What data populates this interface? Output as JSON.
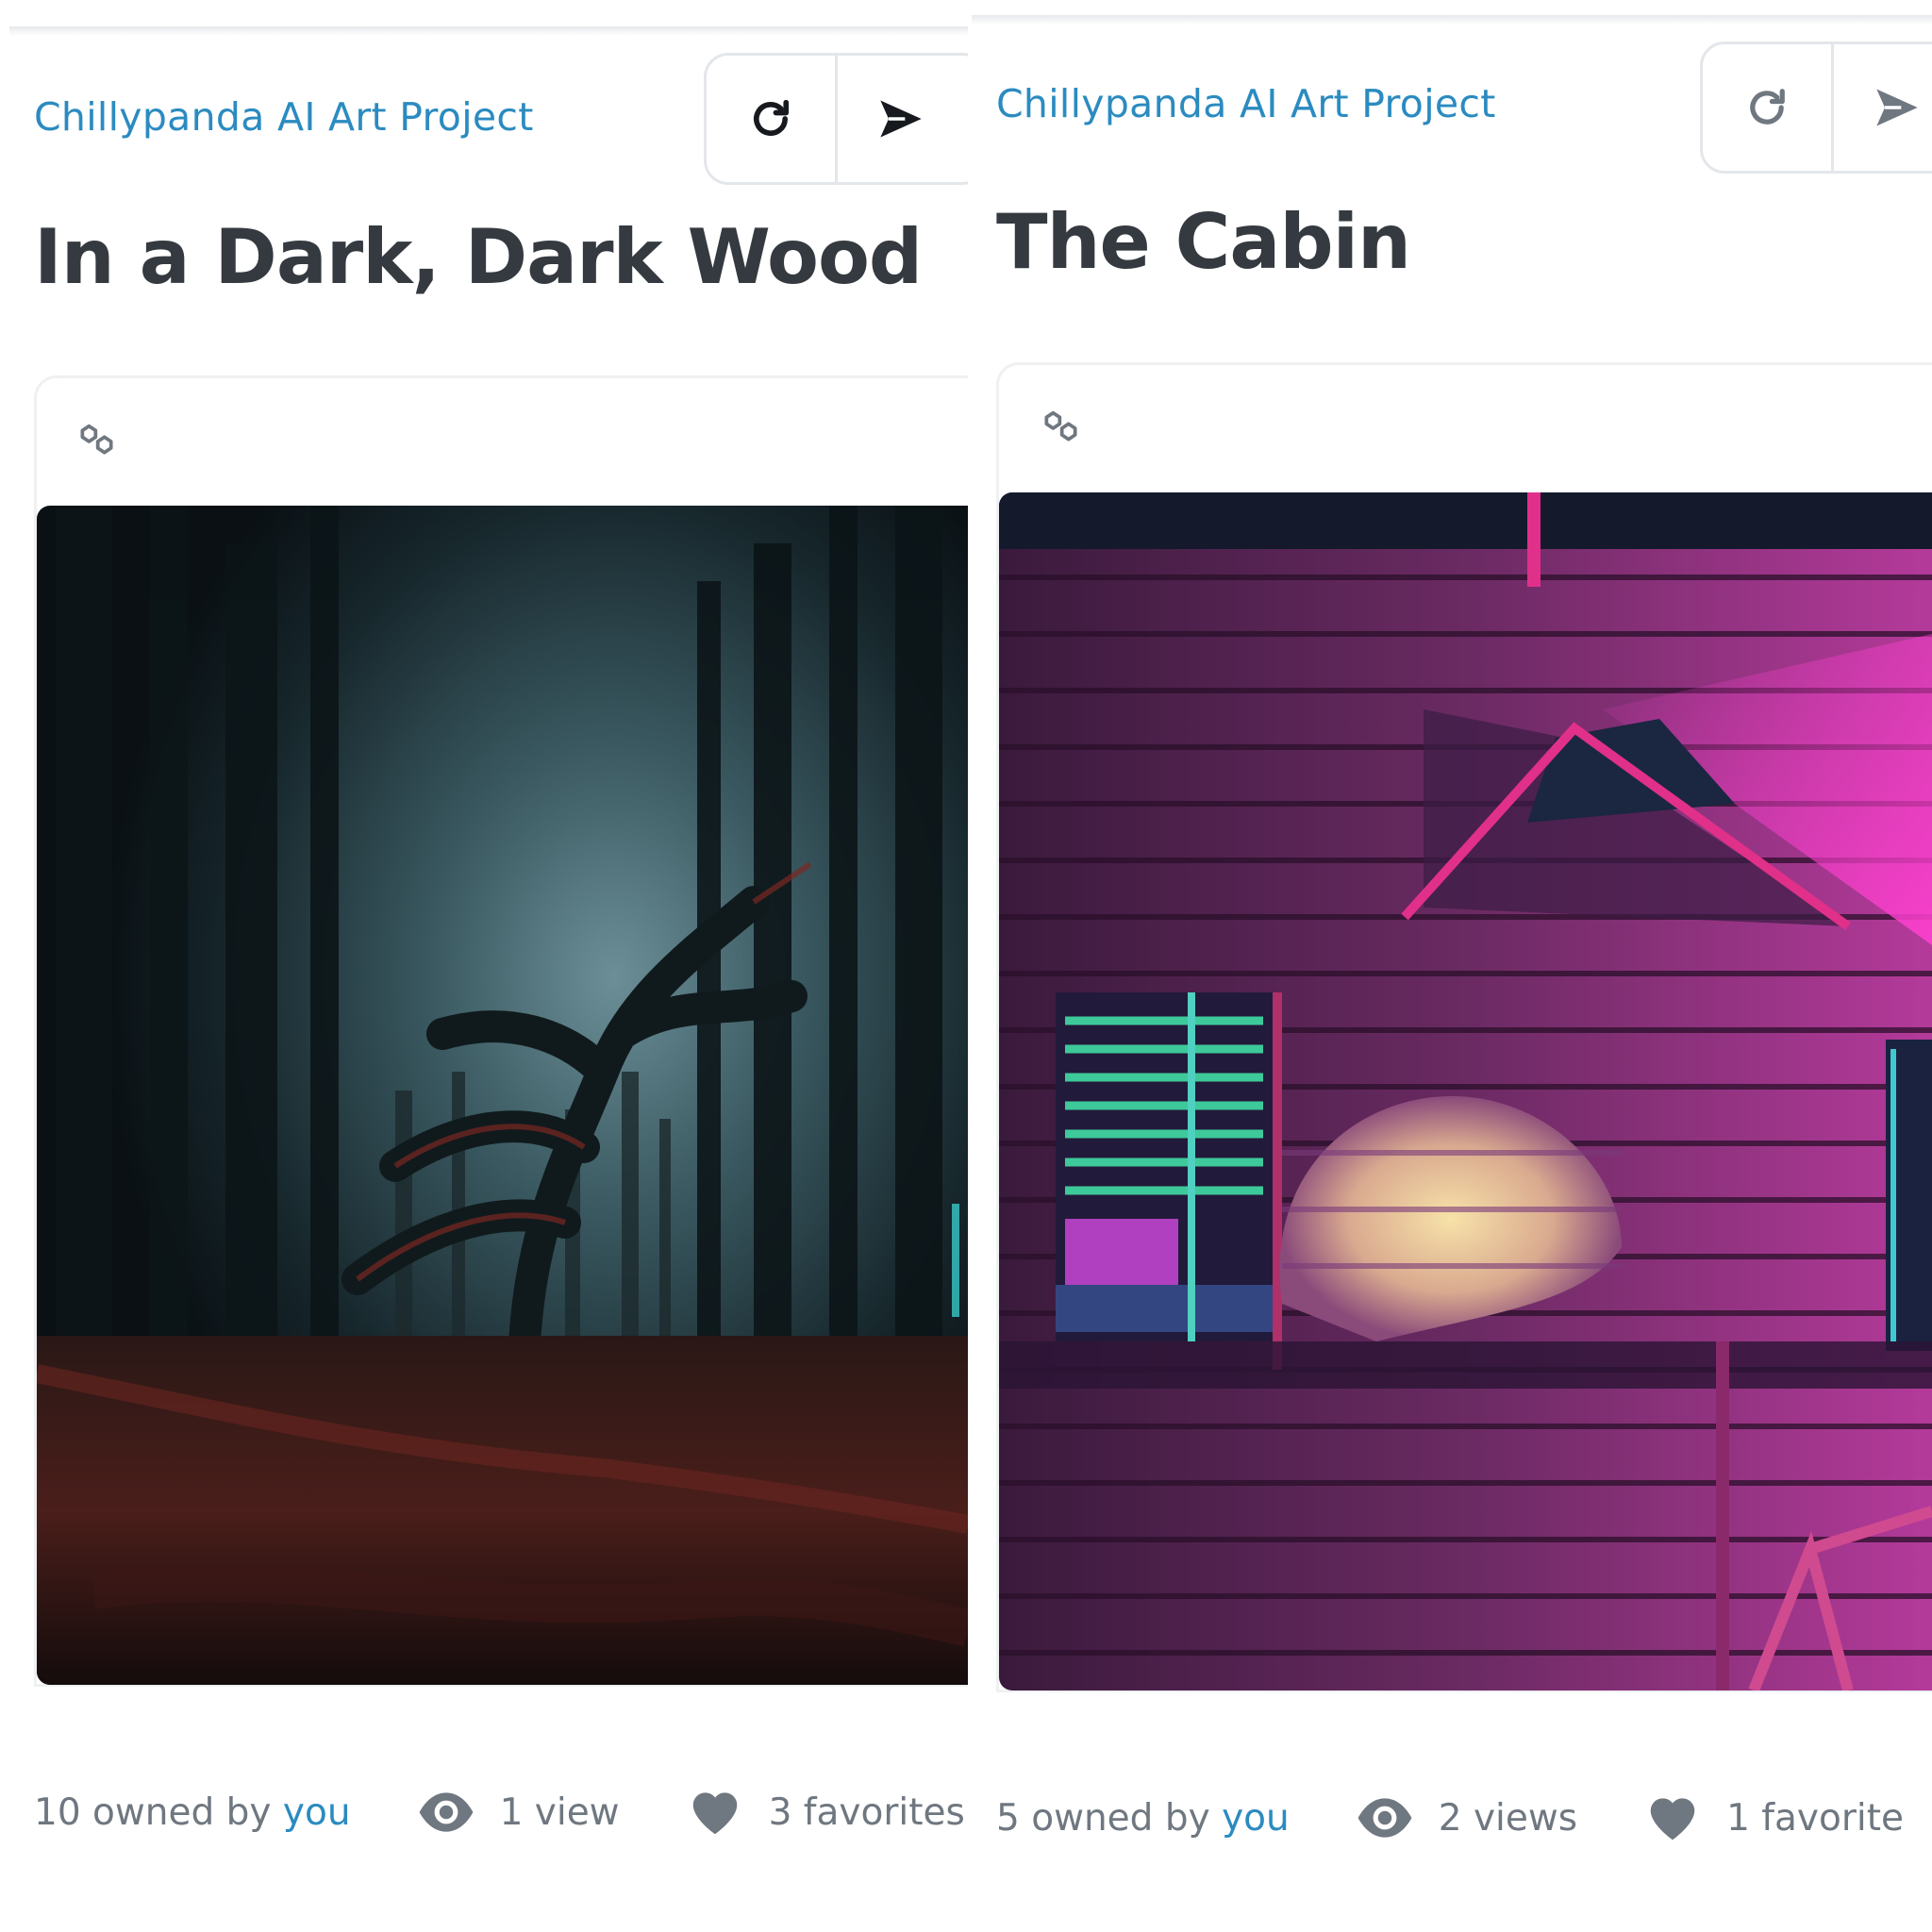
{
  "colors": {
    "collection_link": "#2b8bc0",
    "title": "#353a40",
    "stat_text": "#6f7780",
    "icon": "#6f7780",
    "button_border": "#e3e6ea"
  },
  "panels": [
    {
      "collection": "Chillypanda AI Art Project",
      "title": "In a Dark, Dark Wood",
      "buttons": {
        "refresh_icon": "refresh-icon",
        "share_icon": "send-icon"
      },
      "chain_icon": "polygon-chain-icon",
      "artwork_alt": "dark forest with twisted tree",
      "owned_count": "10 owned by",
      "owned_user": "you",
      "views": "1 view",
      "favorites": "3 favorites"
    },
    {
      "collection": "Chillypanda AI Art Project",
      "title": "The Cabin",
      "buttons": {
        "refresh_icon": "refresh-icon",
        "share_icon": "send-icon"
      },
      "chain_icon": "polygon-chain-icon",
      "artwork_alt": "log cabin in neon purple light",
      "owned_count": "5 owned by",
      "owned_user": "you",
      "views": "2 views",
      "favorites": "1 favorite"
    }
  ]
}
